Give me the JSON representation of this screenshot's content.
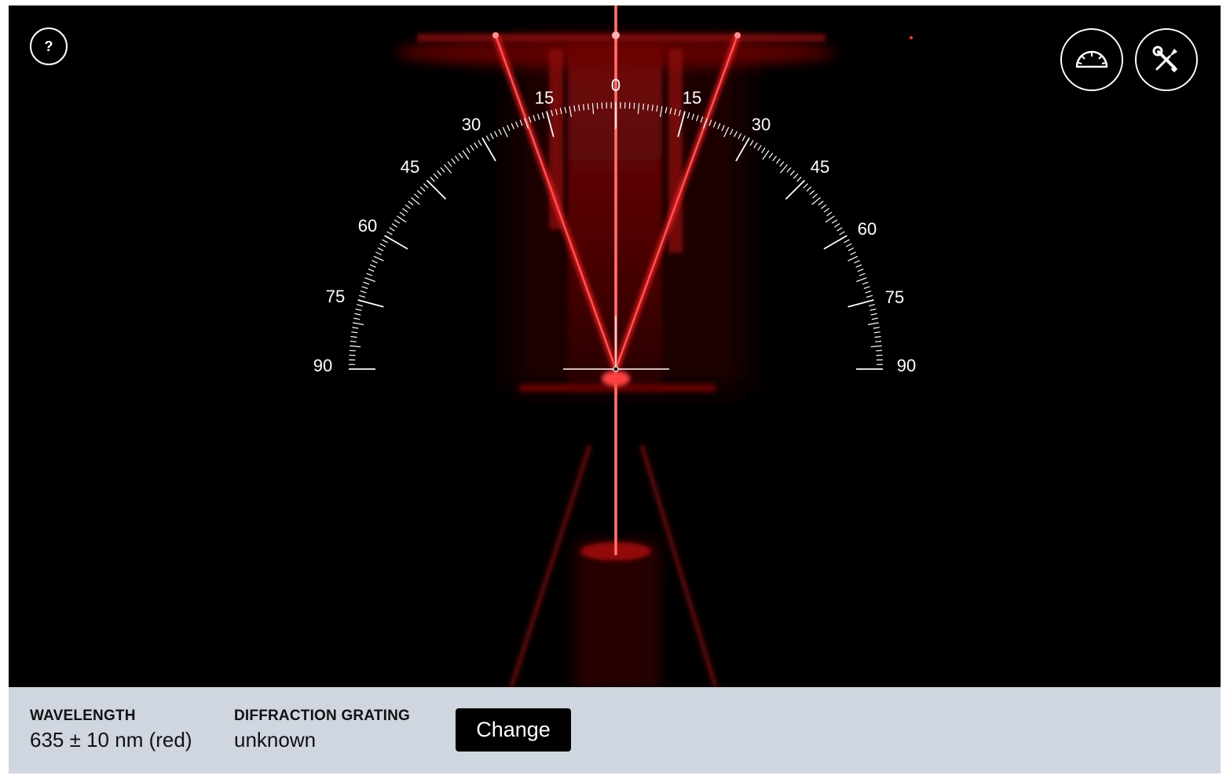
{
  "viewer": {
    "beam_color": "#ff1a1a",
    "scale": {
      "left_labels": [
        "0",
        "15",
        "30",
        "45",
        "60",
        "75",
        "90"
      ],
      "right_labels": [
        "15",
        "30",
        "45",
        "60",
        "75",
        "90"
      ]
    }
  },
  "controls": {
    "help_label": "?",
    "protractor_icon": "protractor-icon",
    "tools_icon": "tools-icon"
  },
  "footer": {
    "wavelength_label": "WAVELENGTH",
    "wavelength_value": "635 ± 10 nm (red)",
    "grating_label": "DIFFRACTION GRATING",
    "grating_value": "unknown",
    "change_label": "Change"
  }
}
